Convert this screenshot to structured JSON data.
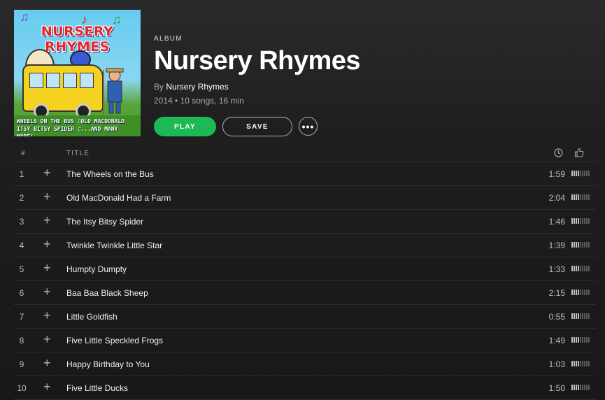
{
  "album": {
    "type_label": "ALBUM",
    "title": "Nursery Rhymes",
    "by_prefix": "By",
    "artist": "Nursery Rhymes",
    "details": "2014 • 10 songs, 16 min",
    "cover": {
      "title": "NURSERY RHYMES",
      "footer_line1": "WHEELS ON THE BUS ♫OLD MACDONALD",
      "footer_line2": "ITSY BITSY SPIDER ♫...AND MANY MORE!"
    }
  },
  "actions": {
    "play_label": "PLAY",
    "save_label": "SAVE",
    "more_label": "•••"
  },
  "table": {
    "header_num": "#",
    "header_title": "TITLE",
    "popularity_segments": 9,
    "tracks": [
      {
        "num": "1",
        "title": "The Wheels on the Bus",
        "duration": "1:59",
        "popularity": 4
      },
      {
        "num": "2",
        "title": "Old MacDonald Had a Farm",
        "duration": "2:04",
        "popularity": 4
      },
      {
        "num": "3",
        "title": "The Itsy Bitsy Spider",
        "duration": "1:46",
        "popularity": 4
      },
      {
        "num": "4",
        "title": "Twinkle Twinkle Little Star",
        "duration": "1:39",
        "popularity": 4
      },
      {
        "num": "5",
        "title": "Humpty Dumpty",
        "duration": "1:33",
        "popularity": 4
      },
      {
        "num": "6",
        "title": "Baa Baa Black Sheep",
        "duration": "2:15",
        "popularity": 4
      },
      {
        "num": "7",
        "title": "Little Goldfish",
        "duration": "0:55",
        "popularity": 4
      },
      {
        "num": "8",
        "title": "Five Little Speckled Frogs",
        "duration": "1:49",
        "popularity": 4
      },
      {
        "num": "9",
        "title": "Happy Birthday to You",
        "duration": "1:03",
        "popularity": 4
      },
      {
        "num": "10",
        "title": "Five Little Ducks",
        "duration": "1:50",
        "popularity": 4
      }
    ]
  },
  "colors": {
    "accent": "#1db954",
    "background": "#181818",
    "text_secondary": "#a8a8a8"
  }
}
